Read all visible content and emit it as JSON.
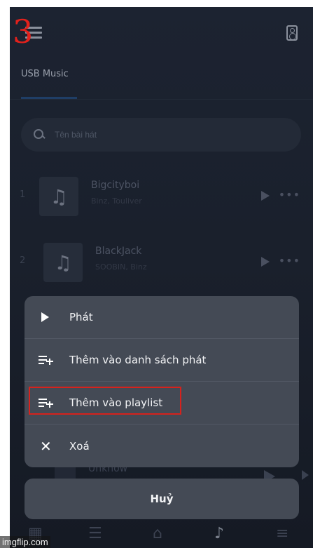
{
  "annotation": {
    "step_number": "3"
  },
  "header": {
    "menu_icon": "hamburger-menu-icon",
    "speaker_icon": "speaker-icon",
    "tab_label": "USB Music"
  },
  "search": {
    "placeholder": "Tên bài hát",
    "icon": "search-icon"
  },
  "songs": [
    {
      "index": "1",
      "title": "Bigcityboi",
      "artist": "Binz, Touliver"
    },
    {
      "index": "2",
      "title": "BlackJack",
      "artist": "SOOBIN, Binz"
    }
  ],
  "now_playing": {
    "label": "Unknow"
  },
  "action_sheet": {
    "items": [
      {
        "label": "Phát",
        "icon": "play-icon"
      },
      {
        "label": "Thêm vào danh sách phát",
        "icon": "playlist-add-icon"
      },
      {
        "label": "Thêm vào playlist",
        "icon": "playlist-add-icon",
        "highlighted": true
      },
      {
        "label": "Xoá",
        "icon": "close-icon"
      }
    ],
    "cancel_label": "Huỷ"
  },
  "bottom_nav": [
    "grid-icon",
    "list-icon",
    "home-icon",
    "music-note-icon",
    "menu-icon"
  ],
  "watermark": "imgflip.com",
  "colors": {
    "highlight": "#d6221d",
    "sheet": "#444a55",
    "background": "#1a202c"
  }
}
